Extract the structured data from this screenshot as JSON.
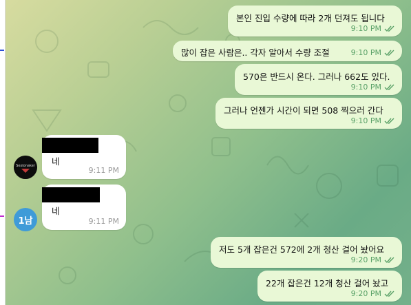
{
  "outgoing": [
    {
      "text": "본인 진입 수량에 따라 2개 던져도 됩니다",
      "time": "9:10 PM"
    },
    {
      "text": "많이 잡은 사람은.. 각자 알아서 수량 조절",
      "time": "9:10 PM"
    },
    {
      "text": "570은 반드시 온다. 그러나 662도 있다.",
      "time": "9:10 PM"
    },
    {
      "text": "그러나 언젠가 시간이 되면 508 찍으러 간다",
      "time": "9:10 PM"
    },
    {
      "text": "저도 5개 잡은건 572에 2개 청산 걸어 놨어요",
      "time": "9:20 PM"
    },
    {
      "text": "22개 잡은건 12개 청산 걸어 놨고",
      "time": "9:20 PM"
    }
  ],
  "incoming": [
    {
      "text": "네",
      "time": "9:11 PM",
      "avatar_text": "Sexionaker"
    },
    {
      "text": "네",
      "time": "9:11 PM",
      "avatar_text": "1남"
    }
  ],
  "colors": {
    "outgoing_bubble": "#e9f8d6",
    "incoming_bubble": "#ffffff",
    "timestamp_green": "#58a066",
    "avatar_blue": "#3f9bd8"
  }
}
